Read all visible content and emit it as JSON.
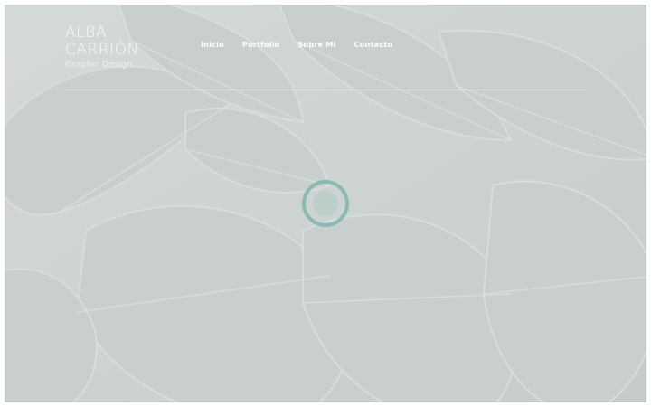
{
  "site": {
    "name_line1": "ALBA",
    "name_line2": "CARRIÓN",
    "tagline": "Graphic Design"
  },
  "nav": {
    "items": [
      {
        "label": "Inicio"
      },
      {
        "label": "Portfolio"
      },
      {
        "label": "Sobre Mi"
      },
      {
        "label": "Contacto"
      }
    ]
  },
  "background": {
    "image": "monstera-leaves"
  },
  "loader": {
    "icon": "loading-spinner-icon",
    "color": "#7fb5ae"
  },
  "colors": {
    "overlay": "#c9cfcd",
    "text": "#ffffff",
    "accent": "#7fb5ae"
  }
}
